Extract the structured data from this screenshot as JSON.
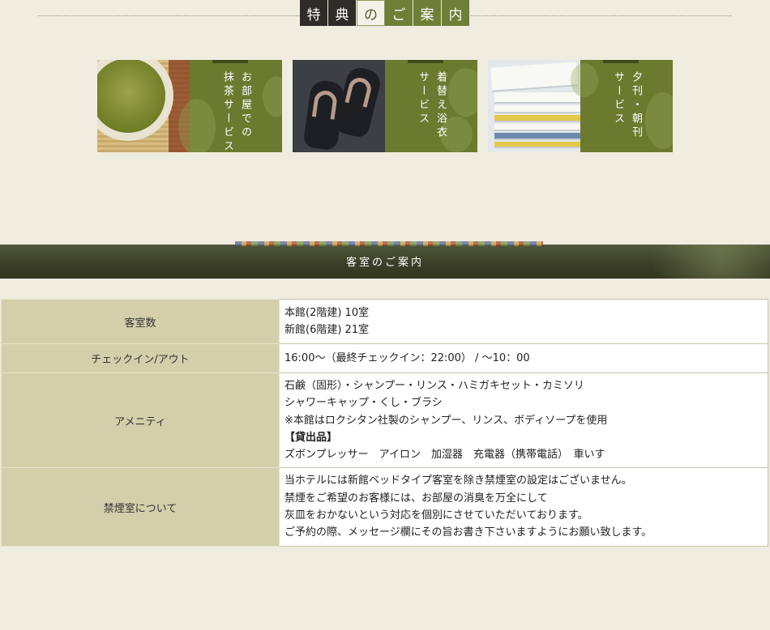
{
  "benefits": {
    "title_chars": [
      "特",
      "典",
      "の",
      "ご",
      "案",
      "内"
    ],
    "cards": [
      {
        "label": "お部屋での\n抹茶サービス",
        "photo": "matcha-photo"
      },
      {
        "label": "着替え浴衣\nサービス",
        "photo": "geta-photo"
      },
      {
        "label": "夕刊・朝刊\nサービス",
        "photo": "newspaper-photo"
      }
    ]
  },
  "rooms_banner": {
    "title": "客室のご案内"
  },
  "info_table": {
    "rows": [
      {
        "header": "客室数",
        "lines": [
          "本館(2階建) 10室",
          "新館(6階建) 21室"
        ]
      },
      {
        "header": "チェックイン/アウト",
        "lines": [
          "16:00～（最終チェックイン：22:00） / ～10：00"
        ]
      },
      {
        "header": "アメニティ",
        "lines": [
          "石鹸（固形）・シャンプー・リンス・ハミガキセット・カミソリ",
          "シャワーキャップ・くし・ブラシ",
          "※本館はロクシタン社製のシャンプー、リンス、ボディソープを使用",
          "【貸出品】",
          "ズボンプレッサー　アイロン　加湿器　充電器（携帯電話）　車いす"
        ]
      },
      {
        "header": "禁煙室について",
        "lines": [
          "当ホテルには新館ベッドタイプ客室を除き禁煙室の設定はございません。",
          "禁煙をご希望のお客様には、お部屋の消臭を万全にして",
          "灰皿をおかないという対応を個別にさせていただいております。",
          "ご予約の際、メッセージ欄にその旨お書き下さいますようにお願い致します。"
        ]
      }
    ]
  },
  "colors": {
    "accent_green": "#6c7a30",
    "header_dark": "#2d2c27",
    "table_header": "#d3cfaa",
    "background": "#efece0"
  }
}
